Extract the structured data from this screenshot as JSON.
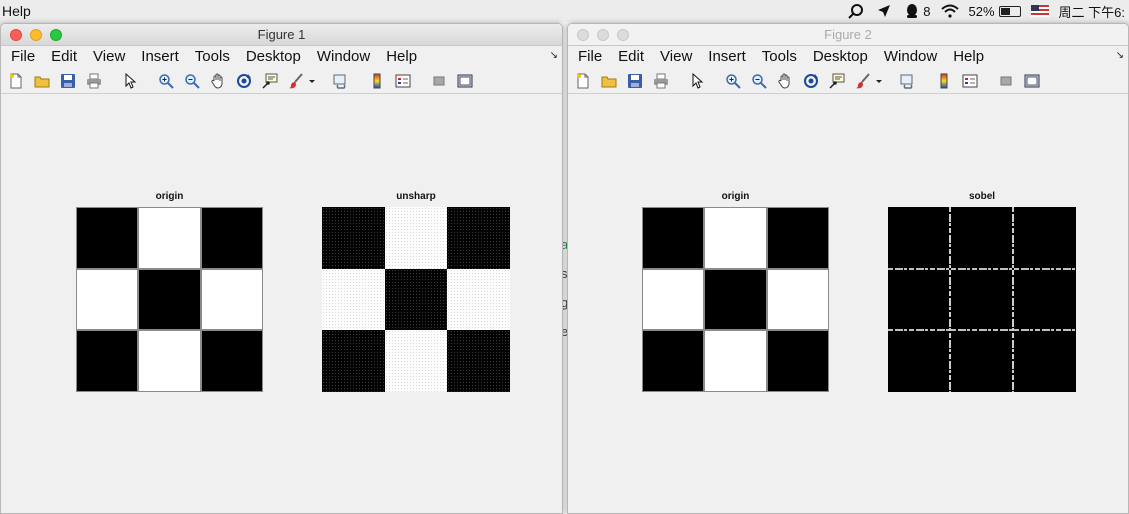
{
  "system_menubar": {
    "app_menu": "Help",
    "battery_percent": "52%",
    "battery_level": 0.52,
    "qq_badge": "8",
    "clock": "周二 下午6:",
    "status_icons": [
      "spotlight-icon",
      "location-arrow-icon",
      "qq-icon",
      "wifi-icon",
      "battery-icon",
      "us-flag-icon"
    ]
  },
  "background_window": {
    "glimpse_chars": [
      "a",
      "s",
      "g",
      "e"
    ]
  },
  "figures": [
    {
      "title": "Figure 1",
      "active": true,
      "menus": [
        "File",
        "Edit",
        "View",
        "Insert",
        "Tools",
        "Desktop",
        "Window",
        "Help"
      ],
      "toolbar": [
        "new-figure-icon",
        "open-file-icon",
        "save-icon",
        "print-icon",
        "pointer-icon",
        "zoom-in-icon",
        "zoom-out-icon",
        "pan-hand-icon",
        "rotate-3d-icon",
        "data-cursor-icon",
        "brush-icon",
        "brush-dropdown-icon",
        "link-plot-icon",
        "colorbar-icon",
        "legend-icon",
        "hide-plot-tools-icon",
        "show-plot-tools-icon"
      ],
      "axes": [
        {
          "title": "origin",
          "pattern": [
            [
              0,
              1,
              0
            ],
            [
              1,
              0,
              1
            ],
            [
              0,
              1,
              0
            ]
          ]
        },
        {
          "title": "unsharp",
          "pattern": [
            [
              0,
              1,
              0
            ],
            [
              1,
              0,
              1
            ],
            [
              0,
              1,
              0
            ]
          ]
        }
      ]
    },
    {
      "title": "Figure 2",
      "active": false,
      "menus": [
        "File",
        "Edit",
        "View",
        "Insert",
        "Tools",
        "Desktop",
        "Window",
        "Help"
      ],
      "toolbar": [
        "new-figure-icon",
        "open-file-icon",
        "save-icon",
        "print-icon",
        "pointer-icon",
        "zoom-in-icon",
        "zoom-out-icon",
        "pan-hand-icon",
        "rotate-3d-icon",
        "data-cursor-icon",
        "brush-icon",
        "brush-dropdown-icon",
        "link-plot-icon",
        "colorbar-icon",
        "legend-icon",
        "hide-plot-tools-icon",
        "show-plot-tools-icon"
      ],
      "axes": [
        {
          "title": "origin",
          "pattern": [
            [
              0,
              1,
              0
            ],
            [
              1,
              0,
              1
            ],
            [
              0,
              1,
              0
            ]
          ]
        },
        {
          "title": "sobel",
          "pattern": []
        }
      ]
    }
  ],
  "colors": {
    "figure_bg": "#f0f0f0",
    "black": "#000000",
    "white": "#ffffff",
    "edge": "#ffffff"
  }
}
